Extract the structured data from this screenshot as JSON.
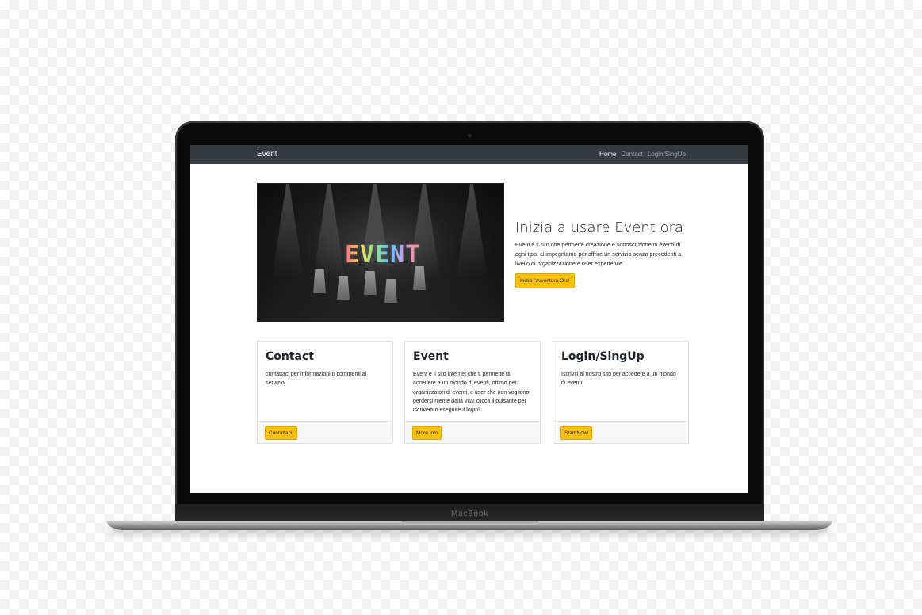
{
  "device": {
    "brand_label": "MacBook"
  },
  "navbar": {
    "brand": "Event",
    "links": [
      {
        "label": "Home",
        "active": true
      },
      {
        "label": "Contact",
        "active": false
      },
      {
        "label": "Login/SingUp",
        "active": false
      }
    ]
  },
  "hero": {
    "image_label": "EVENT",
    "title": "Inizia a usare Event ora",
    "text": "Event è il sito che permette creazione e sottoscrizione di eventi di ogni tipo, ci impegniamo per offrire un servizio senza precedenti a livello di organizzazione e user experience.",
    "button_label": "Inizia l'avventura Ora!"
  },
  "cards": [
    {
      "title": "Contact",
      "text": "contattaci per informazioni o commenti al servizio!",
      "button_label": "Contattaci!"
    },
    {
      "title": "Event",
      "text": "Event è il sito internet che ti permette di accedere a un mondo di eventi, ottimo per organizzatori di eventi, e user che non vogliono perdersi niente dalla vita! clicca il pulsante per iscriverti o eseguire il login!",
      "button_label": "More Info"
    },
    {
      "title": "Login/SingUp",
      "text": "Iscriviti al nostro sito per accedere a un mondo di eventi!",
      "button_label": "Start Now!"
    }
  ],
  "colors": {
    "navbar_bg": "#343a40",
    "button_bg": "#ffc107",
    "text": "#212529"
  }
}
